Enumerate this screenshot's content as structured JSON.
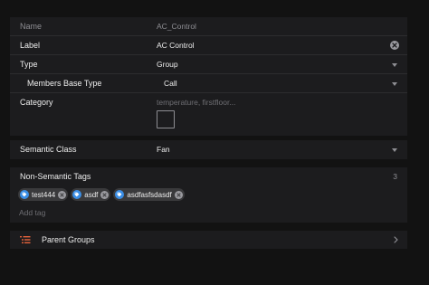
{
  "general": {
    "name_label": "Name",
    "name_value": "AC_Control",
    "label_label": "Label",
    "label_value": "AC Control",
    "type_label": "Type",
    "type_value": "Group",
    "members_label": "Members Base Type",
    "members_value": "Call",
    "category_label": "Category",
    "category_placeholder": "temperature, firstfloor..."
  },
  "semantic": {
    "label": "Semantic Class",
    "value": "Fan"
  },
  "tags": {
    "label": "Non-Semantic Tags",
    "count": "3",
    "items": [
      {
        "label": "test444"
      },
      {
        "label": "asdf"
      },
      {
        "label": "asdfasfsdasdf"
      }
    ],
    "add_placeholder": "Add tag"
  },
  "groups": {
    "label": "Parent Groups"
  },
  "colors": {
    "background": "#121212",
    "card": "#1c1c1e",
    "accent": "#3a8ee6",
    "chip": "#3a3a3c"
  }
}
